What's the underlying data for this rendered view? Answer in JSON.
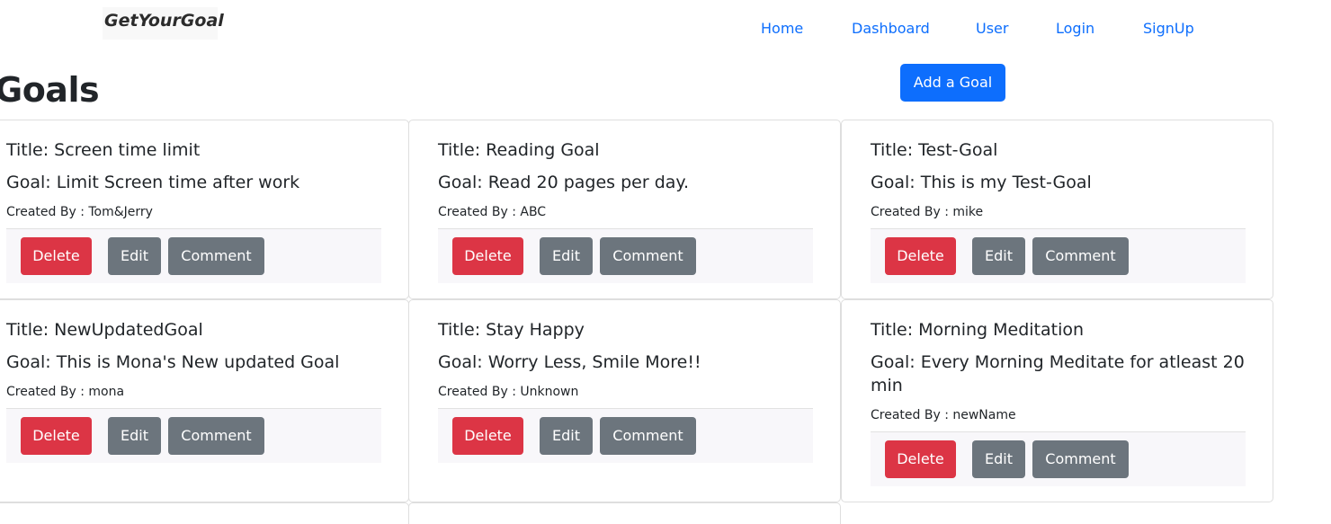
{
  "brand": "GetYourGoal",
  "nav": [
    "Home",
    "Dashboard",
    "User",
    "Login",
    "SignUp"
  ],
  "heading": "Goals",
  "add_button": "Add a Goal",
  "buttons": {
    "delete": "Delete",
    "edit": "Edit",
    "comment": "Comment"
  },
  "cards": [
    {
      "title": "Title: Screen time limit",
      "goal": "Goal: Limit Screen time after work",
      "created_by": "Created By : Tom&Jerry"
    },
    {
      "title": "Title: Reading Goal",
      "goal": "Goal: Read 20 pages per day.",
      "created_by": "Created By : ABC"
    },
    {
      "title": "Title: Test-Goal",
      "goal": "Goal: This is my Test-Goal",
      "created_by": "Created By : mike"
    },
    {
      "title": "Title: NewUpdatedGoal",
      "goal": "Goal: This is Mona's New updated Goal",
      "created_by": "Created By : mona"
    },
    {
      "title": "Title: Stay Happy",
      "goal": "Goal: Worry Less, Smile More!!",
      "created_by": "Created By : Unknown"
    },
    {
      "title": "Title: Morning Meditation",
      "goal": "Goal: Every Morning Meditate for atleast 20 min",
      "created_by": "Created By : newName"
    }
  ],
  "colors": {
    "primary": "#0d6efd",
    "danger": "#dc3545",
    "secondary": "#6c757d"
  }
}
